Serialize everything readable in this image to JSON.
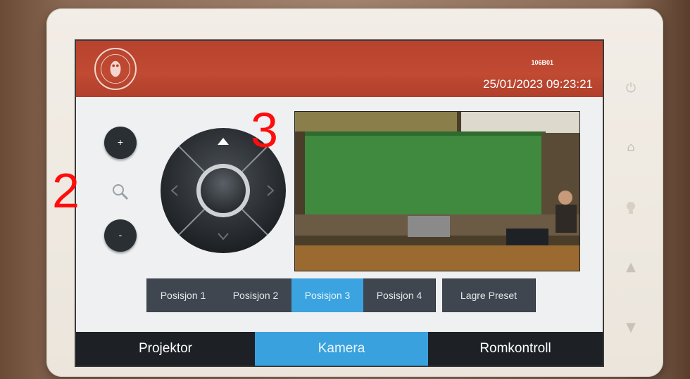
{
  "header": {
    "room_id": "106B01",
    "datetime": "25/01/2023 09:23:21"
  },
  "zoom": {
    "in_label": "+",
    "out_label": "-"
  },
  "presets": [
    {
      "label": "Posisjon 1",
      "active": false
    },
    {
      "label": "Posisjon 2",
      "active": false
    },
    {
      "label": "Posisjon 3",
      "active": true
    },
    {
      "label": "Posisjon 4",
      "active": false
    }
  ],
  "save_preset_label": "Lagre Preset",
  "tabs": [
    {
      "label": "Projektor",
      "active": false
    },
    {
      "label": "Kamera",
      "active": true
    },
    {
      "label": "Romkontroll",
      "active": false
    }
  ],
  "annotations": {
    "zoom_marker": "2",
    "camera_marker": "3"
  },
  "colors": {
    "header_red": "#b8432e",
    "accent_blue": "#39a2de",
    "tab_dark": "#1d2126",
    "preset_gray": "#3f4650",
    "annotation_red": "#ff0d0d"
  },
  "icons": {
    "hardware": [
      "power-icon",
      "home-icon",
      "lightbulb-icon",
      "volume-up-icon",
      "volume-down-icon"
    ],
    "zoom": "magnifier-icon"
  }
}
